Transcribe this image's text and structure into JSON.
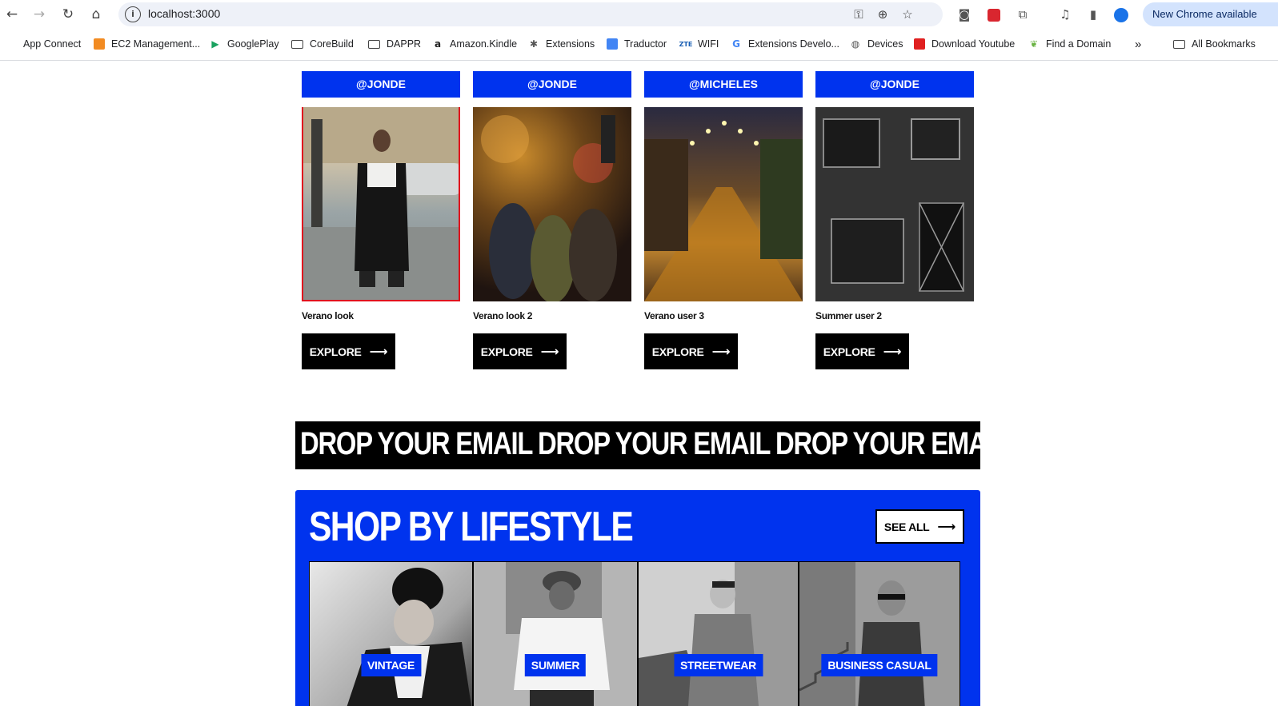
{
  "browser": {
    "url": "localhost:3000",
    "update_label": "New Chrome available",
    "bookmarks": [
      {
        "label": "App Connect",
        "icon": "apple-icon"
      },
      {
        "label": "EC2 Management...",
        "icon": "aws-cube-icon"
      },
      {
        "label": "GooglePlay",
        "icon": "play-icon"
      },
      {
        "label": "CoreBuild",
        "icon": "folder-icon"
      },
      {
        "label": "DAPPR",
        "icon": "folder-icon"
      },
      {
        "label": "Amazon.Kindle",
        "icon": "amazon-icon"
      },
      {
        "label": "Extensions",
        "icon": "puzzle-icon"
      },
      {
        "label": "Traductor",
        "icon": "translate-icon"
      },
      {
        "label": "WIFI",
        "icon": "zte-icon"
      },
      {
        "label": "Extensions Develo...",
        "icon": "google-icon"
      },
      {
        "label": "Devices",
        "icon": "globe-icon"
      },
      {
        "label": "Download Youtube",
        "icon": "download-icon"
      },
      {
        "label": "Find a Domain",
        "icon": "leaf-icon"
      }
    ],
    "overflow_label": "»",
    "all_bookmarks_label": "All Bookmarks"
  },
  "looks": [
    {
      "handle": "@JONDE",
      "title": "Verano look",
      "explore_label": "EXPLORE"
    },
    {
      "handle": "@JONDE",
      "title": "Verano look 2",
      "explore_label": "EXPLORE"
    },
    {
      "handle": "@MICHELES",
      "title": "Verano user 3",
      "explore_label": "EXPLORE"
    },
    {
      "handle": "@JONDE",
      "title": "Summer user 2",
      "explore_label": "EXPLORE"
    }
  ],
  "marquee": {
    "text": [
      "DROP YOUR EMAIL",
      "DROP YOUR EMAIL",
      "DROP YOUR EMAIL"
    ]
  },
  "lifestyle": {
    "heading": "SHOP BY LIFESTYLE",
    "see_all_label": "SEE ALL",
    "categories": [
      "VINTAGE",
      "SUMMER",
      "STREETWEAR",
      "BUSINESS CASUAL"
    ]
  },
  "colors": {
    "brand_blue": "#0033ee",
    "black": "#000000",
    "accent_red": "#e0101e"
  }
}
